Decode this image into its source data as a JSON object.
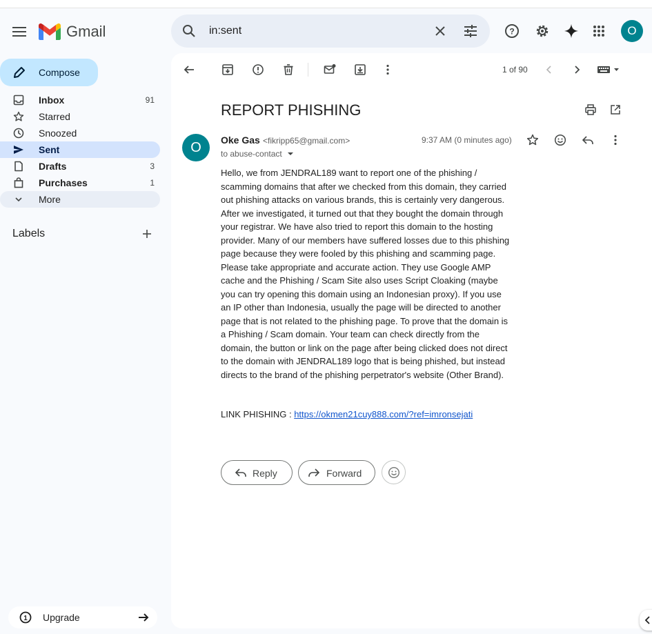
{
  "app": {
    "name": "Gmail"
  },
  "search": {
    "value": "in:sent"
  },
  "compose": {
    "label": "Compose"
  },
  "nav": [
    {
      "label": "Inbox",
      "count": "91",
      "bold": true
    },
    {
      "label": "Starred",
      "count": ""
    },
    {
      "label": "Snoozed",
      "count": ""
    },
    {
      "label": "Sent",
      "count": "",
      "active": true
    },
    {
      "label": "Drafts",
      "count": "3",
      "bold": true
    },
    {
      "label": "Purchases",
      "count": "1",
      "bold": true
    },
    {
      "label": "More",
      "count": ""
    }
  ],
  "labels": {
    "title": "Labels"
  },
  "upgrade": {
    "label": "Upgrade"
  },
  "user": {
    "initial": "O"
  },
  "pager": {
    "text": "1 of 90"
  },
  "email": {
    "subject": "REPORT PHISHING",
    "sender_name": "Oke Gas",
    "sender_email": "<fikripp65@gmail.com>",
    "to": "to abuse-contact",
    "time": "9:37 AM (0 minutes ago)",
    "avatar_initial": "O",
    "body": "Hello, we from JENDRAL189 want to report one of the phishing / scamming domains that after we checked from this domain, they carried out phishing attacks on various brands, this is certainly very dangerous. After we investigated, it turned out that they bought the domain through your registrar. We have also tried to report this domain to the hosting provider. Many of our members have suffered losses due to this phishing page because they were fooled by this phishing and scamming page. Please take appropriate and accurate action. They use Google AMP cache and the Phishing / Scam Site also uses Script Cloaking (maybe you can try opening this domain using an Indonesian proxy). If you use an IP other than Indonesia, usually the page will be directed to another page that is not related to the phishing page. To prove that the domain is a Phishing / Scam domain. Your team can check directly from the domain, the button or link on the page after being clicked does not direct to the domain with JENDRAL189 logo that is being phished, but instead directs to the brand of the phishing perpetrator's website (Other Brand).",
    "link_label": "LINK PHISHING : ",
    "link_url": "https://okmen21cuy888.com/?ref=imronsejati"
  },
  "actions": {
    "reply": "Reply",
    "forward": "Forward"
  },
  "colors": {
    "accent": "#c2e7ff",
    "active_nav": "#d3e3fd",
    "avatar": "#00838f",
    "link": "#1155cc"
  }
}
